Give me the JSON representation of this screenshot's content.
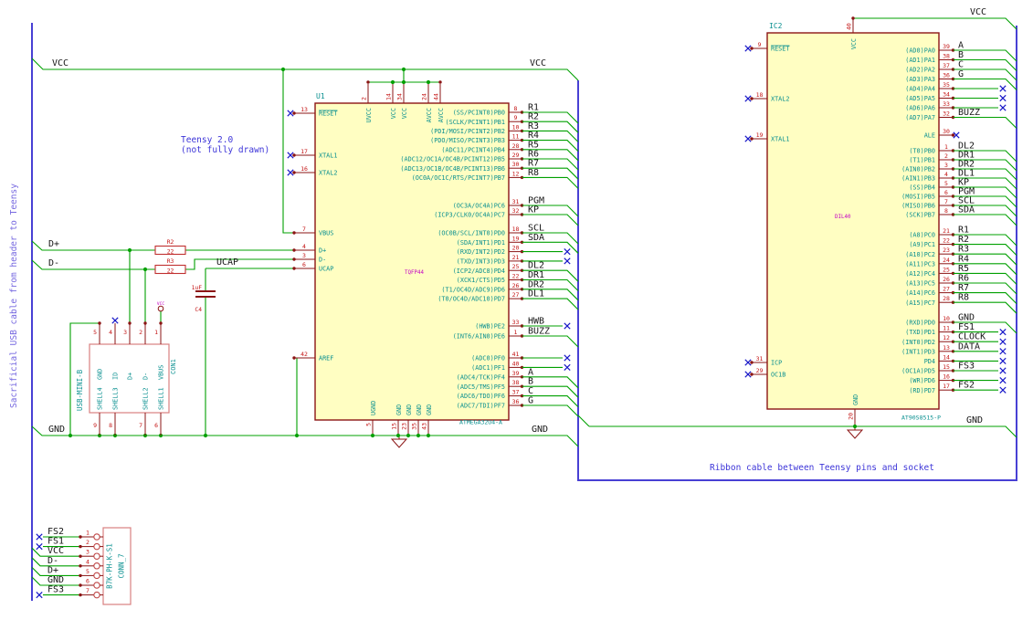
{
  "colors": {
    "wire": "#00a000",
    "bus": "#4840d4",
    "outline": "#8b1414",
    "fill": "#fffec2",
    "pin_number": "#c41414",
    "pin_name": "#0a9090",
    "footprint": "#c400c4",
    "noconnect": "#1616c8",
    "note": "#3c34d8",
    "note_light": "#7668e0",
    "label": "#161616",
    "connector": "#d98080"
  },
  "notes": {
    "teensy_line1": "Teensy 2.0",
    "teensy_line2": "(not fully drawn)",
    "ribbon": "Ribbon cable between Teensy pins and socket",
    "sacrificial": "Sacrificial USB cable from header to Teensy"
  },
  "labels": {
    "vcc1": "VCC",
    "vcc2": "VCC",
    "vcc3": "VCC",
    "gnd1": "GND",
    "gnd2": "GND",
    "gnd3": "GND",
    "dplus": "D+",
    "dminus": "D-",
    "ucap": "UCAP"
  },
  "u1": {
    "ref": "U1",
    "value": "ATMEGA32U4-A",
    "footprint": "TQFP44",
    "left_pins": [
      {
        "num": "13",
        "name": "RESET",
        "term": "x"
      },
      {
        "num": "17",
        "name": "XTAL1",
        "term": "x"
      },
      {
        "num": "16",
        "name": "XTAL2",
        "term": "x"
      },
      {
        "num": "7",
        "name": "VBUS",
        "term": "wire"
      },
      {
        "num": "4",
        "name": "D+",
        "term": "wire"
      },
      {
        "num": "3",
        "name": "D-",
        "term": "wire"
      },
      {
        "num": "6",
        "name": "UCAP",
        "term": "wire"
      },
      {
        "num": "42",
        "name": "AREF",
        "term": "wire"
      }
    ],
    "top_pins": [
      {
        "num": "2",
        "name": "UVCC"
      },
      {
        "num": "14",
        "name": "VCC"
      },
      {
        "num": "34",
        "name": "VCC"
      },
      {
        "num": "24",
        "name": "AVCC"
      },
      {
        "num": "44",
        "name": "AVCC"
      }
    ],
    "bottom_pins": [
      {
        "num": "5",
        "name": "UGND"
      },
      {
        "num": "15",
        "name": "GND"
      },
      {
        "num": "23",
        "name": "GND"
      },
      {
        "num": "35",
        "name": "GND"
      },
      {
        "num": "43",
        "name": "GND"
      }
    ],
    "right_groups": {
      "pb": [
        {
          "num": "8",
          "name": "(SS/PCINT0)PB0",
          "label": "R1",
          "term": "diag"
        },
        {
          "num": "9",
          "name": "(SCLK/PCINT1)PB1",
          "label": "R2",
          "term": "diag"
        },
        {
          "num": "10",
          "name": "(PDI/MOSI/PCINT2)PB2",
          "label": "R3",
          "term": "diag"
        },
        {
          "num": "11",
          "name": "(PDO/MISO/PCINT3)PB3",
          "label": "R4",
          "term": "diag"
        },
        {
          "num": "28",
          "name": "(ADC11/PCINT4)PB4",
          "label": "R5",
          "term": "diag"
        },
        {
          "num": "29",
          "name": "(ADC12/OC1A/OC4B/PCINT12)PB5",
          "label": "R6",
          "term": "diag"
        },
        {
          "num": "30",
          "name": "(ADC13/OC1B/OC4B/PCINT13)PB6",
          "label": "R7",
          "term": "diag"
        },
        {
          "num": "12",
          "name": "(OC0A/OC1C/RTS/PCINT7)PB7",
          "label": "R8",
          "term": "diag"
        }
      ],
      "pc": [
        {
          "num": "31",
          "name": "(OC3A/OC4A)PC6",
          "label": "PGM",
          "term": "diag"
        },
        {
          "num": "32",
          "name": "(ICP3/CLK0/OC4A)PC7",
          "label": "KP",
          "term": "diag"
        }
      ],
      "pd": [
        {
          "num": "18",
          "name": "(OC0B/SCL/INT0)PD0",
          "label": "SCL",
          "term": "diag"
        },
        {
          "num": "19",
          "name": "(SDA/INT1)PD1",
          "label": "SDA",
          "term": "diag"
        },
        {
          "num": "20",
          "name": "(RXD/INT2)PD2",
          "label": "",
          "term": "x"
        },
        {
          "num": "21",
          "name": "(TXD/INT3)PD3",
          "label": "",
          "term": "x"
        },
        {
          "num": "25",
          "name": "(ICP2/ADC8)PD4",
          "label": "DL2",
          "term": "diag"
        },
        {
          "num": "22",
          "name": "(XCK1/CTS)PD5",
          "label": "DR1",
          "term": "diag"
        },
        {
          "num": "26",
          "name": "(T1/OC4D/ADC9)PD6",
          "label": "DR2",
          "term": "diag"
        },
        {
          "num": "27",
          "name": "(T0/OC4D/ADC10)PD7",
          "label": "DL1",
          "term": "diag"
        }
      ],
      "pe": [
        {
          "num": "33",
          "name": "(HWB)PE2",
          "label": "HWB",
          "term": "x"
        },
        {
          "num": "1",
          "name": "(INT6/AIN0)PE6",
          "label": "BUZZ",
          "term": "diag"
        }
      ],
      "pf": [
        {
          "num": "41",
          "name": "(ADC0)PF0",
          "label": "",
          "term": "x"
        },
        {
          "num": "40",
          "name": "(ADC1)PF1",
          "label": "",
          "term": "x"
        },
        {
          "num": "39",
          "name": "(ADC4/TCK)PF4",
          "label": "A",
          "term": "diag"
        },
        {
          "num": "38",
          "name": "(ADC5/TMS)PF5",
          "label": "B",
          "term": "diag"
        },
        {
          "num": "37",
          "name": "(ADC6/TDO)PF6",
          "label": "C",
          "term": "diag"
        },
        {
          "num": "36",
          "name": "(ADC7/TDI)PF7",
          "label": "G",
          "term": "diag"
        }
      ]
    }
  },
  "ic2": {
    "ref": "IC2",
    "value": "AT90S8515-P",
    "footprint": "DIL40",
    "left_pins": [
      {
        "num": "9",
        "name": "RESET"
      },
      {
        "num": "18",
        "name": "XTAL2"
      },
      {
        "num": "19",
        "name": "XTAL1"
      },
      {
        "num": "31",
        "name": "ICP"
      },
      {
        "num": "29",
        "name": "OC1B"
      }
    ],
    "top_pin": {
      "num": "40",
      "name": "VCC"
    },
    "bottom_pin": {
      "num": "20",
      "name": "GND"
    },
    "right_groups": {
      "pa": [
        {
          "num": "39",
          "name": "(AD0)PA0",
          "label": "A",
          "term": "diag"
        },
        {
          "num": "38",
          "name": "(AD1)PA1",
          "label": "B",
          "term": "diag"
        },
        {
          "num": "37",
          "name": "(AD2)PA2",
          "label": "C",
          "term": "diag"
        },
        {
          "num": "36",
          "name": "(AD3)PA3",
          "label": "G",
          "term": "diag"
        },
        {
          "num": "35",
          "name": "(AD4)PA4",
          "label": "",
          "term": "x"
        },
        {
          "num": "34",
          "name": "(AD5)PA5",
          "label": "",
          "term": "x"
        },
        {
          "num": "33",
          "name": "(AD6)PA6",
          "label": "",
          "term": "x"
        },
        {
          "num": "32",
          "name": "(AD7)PA7",
          "label": "BUZZ",
          "term": "diag"
        }
      ],
      "ale": [
        {
          "num": "30",
          "name": "ALE",
          "label": "",
          "term": "xshort"
        }
      ],
      "pb": [
        {
          "num": "1",
          "name": "(T0)PB0",
          "label": "DL2",
          "term": "diag"
        },
        {
          "num": "2",
          "name": "(T1)PB1",
          "label": "DR1",
          "term": "diag"
        },
        {
          "num": "3",
          "name": "(AIN0)PB2",
          "label": "DR2",
          "term": "diag"
        },
        {
          "num": "4",
          "name": "(AIN1)PB3",
          "label": "DL1",
          "term": "diag"
        },
        {
          "num": "5",
          "name": "(SS)PB4",
          "label": "KP",
          "term": "diag"
        },
        {
          "num": "6",
          "name": "(MOSI)PB5",
          "label": "PGM",
          "term": "diag"
        },
        {
          "num": "7",
          "name": "(MISO)PB6",
          "label": "SCL",
          "term": "diag"
        },
        {
          "num": "8",
          "name": "(SCK)PB7",
          "label": "SDA",
          "term": "diag"
        }
      ],
      "pc": [
        {
          "num": "21",
          "name": "(A8)PC0",
          "label": "R1",
          "term": "diag"
        },
        {
          "num": "22",
          "name": "(A9)PC1",
          "label": "R2",
          "term": "diag"
        },
        {
          "num": "23",
          "name": "(A10)PC2",
          "label": "R3",
          "term": "diag"
        },
        {
          "num": "24",
          "name": "(A11)PC3",
          "label": "R4",
          "term": "diag"
        },
        {
          "num": "25",
          "name": "(A12)PC4",
          "label": "R5",
          "term": "diag"
        },
        {
          "num": "26",
          "name": "(A13)PC5",
          "label": "R6",
          "term": "diag"
        },
        {
          "num": "27",
          "name": "(A14)PC6",
          "label": "R7",
          "term": "diag"
        },
        {
          "num": "28",
          "name": "(A15)PC7",
          "label": "R8",
          "term": "diag"
        }
      ],
      "pd": [
        {
          "num": "10",
          "name": "(RXD)PD0",
          "label": "GND",
          "term": "diag"
        },
        {
          "num": "11",
          "name": "(TXD)PD1",
          "label": "FS1",
          "term": "x"
        },
        {
          "num": "12",
          "name": "(INT0)PD2",
          "label": "CLOCK",
          "term": "x"
        },
        {
          "num": "13",
          "name": "(INT1)PD3",
          "label": "DATA",
          "term": "x"
        },
        {
          "num": "14",
          "name": "PD4",
          "label": "",
          "term": "x"
        },
        {
          "num": "15",
          "name": "(OC1A)PD5",
          "label": "FS3",
          "term": "x"
        },
        {
          "num": "16",
          "name": "(WR)PD6",
          "label": "",
          "term": "x"
        },
        {
          "num": "17",
          "name": "(RD)PD7",
          "label": "FS2",
          "term": "x"
        }
      ]
    }
  },
  "con1": {
    "ref": "CON1",
    "value": "USB-MINI-B",
    "vcc_symbol": "VCC",
    "top_pins": [
      {
        "num": "5",
        "name": "GND",
        "nc": false
      },
      {
        "num": "4",
        "name": "ID",
        "nc": true
      },
      {
        "num": "3",
        "name": "D+",
        "nc": false
      },
      {
        "num": "2",
        "name": "D-",
        "nc": false
      },
      {
        "num": "1",
        "name": "VBUS",
        "nc": false
      }
    ],
    "shell_pins": [
      {
        "num": "9",
        "name": "SHELL4"
      },
      {
        "num": "8",
        "name": "SHELL3"
      },
      {
        "num": "7",
        "name": "SHELL2"
      },
      {
        "num": "6",
        "name": "SHELL1"
      }
    ]
  },
  "conn7": {
    "ref": "CONN_7",
    "value": "B7K-PH-K-S1",
    "rows": [
      {
        "num": "1",
        "label": "FS2",
        "term": "x"
      },
      {
        "num": "2",
        "label": "FS1",
        "term": "x"
      },
      {
        "num": "3",
        "label": "VCC",
        "term": "bus"
      },
      {
        "num": "4",
        "label": "D-",
        "term": "bus"
      },
      {
        "num": "5",
        "label": "D+",
        "term": "bus"
      },
      {
        "num": "6",
        "label": "GND",
        "term": "bus"
      },
      {
        "num": "7",
        "label": "FS3",
        "term": "x"
      }
    ]
  },
  "r2": {
    "ref": "R2",
    "value": "22"
  },
  "r3": {
    "ref": "R3",
    "value": "22"
  },
  "c4": {
    "ref": "C4",
    "value": "1uF"
  }
}
